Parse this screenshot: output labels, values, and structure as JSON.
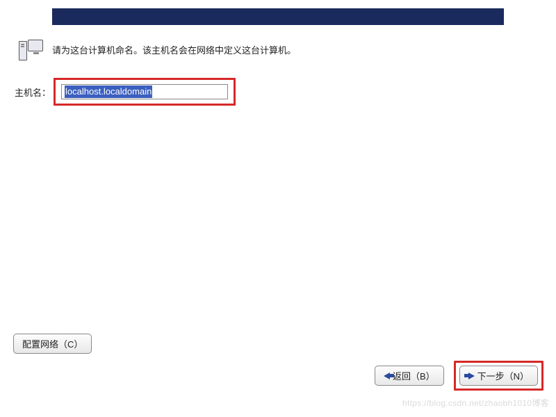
{
  "banner": {
    "color": "#1a2a5c"
  },
  "info": {
    "icon": "computer-network-icon",
    "text": "请为这台计算机命名。该主机名会在网络中定义这台计算机。"
  },
  "hostname": {
    "label": "主机名：",
    "value": "localhost.localdomain"
  },
  "buttons": {
    "configure_network": "配置网络（C）",
    "back": "返回（B）",
    "next": "下一步（N）"
  },
  "highlight_color": "#d62828",
  "watermark": "https://blog.csdn.net/zhaobh1010博客"
}
